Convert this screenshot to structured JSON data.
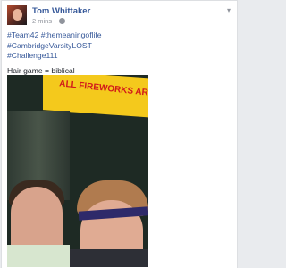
{
  "post": {
    "author": "Tom Whittaker",
    "time": "2 mins",
    "separator": "·",
    "hashtags": [
      "#Team42 #themeaningoflife",
      "#CambridgeVarsityLOST",
      "#Challenge111"
    ],
    "text": "Hair game = biblical"
  },
  "photo": {
    "sign_text": "ALL FIREWORKS AR"
  },
  "icons": {
    "privacy": "globe-icon",
    "options": "chevron-down-icon"
  },
  "colors": {
    "author": "#365899",
    "hashtag": "#365899",
    "meta": "#90949c"
  }
}
